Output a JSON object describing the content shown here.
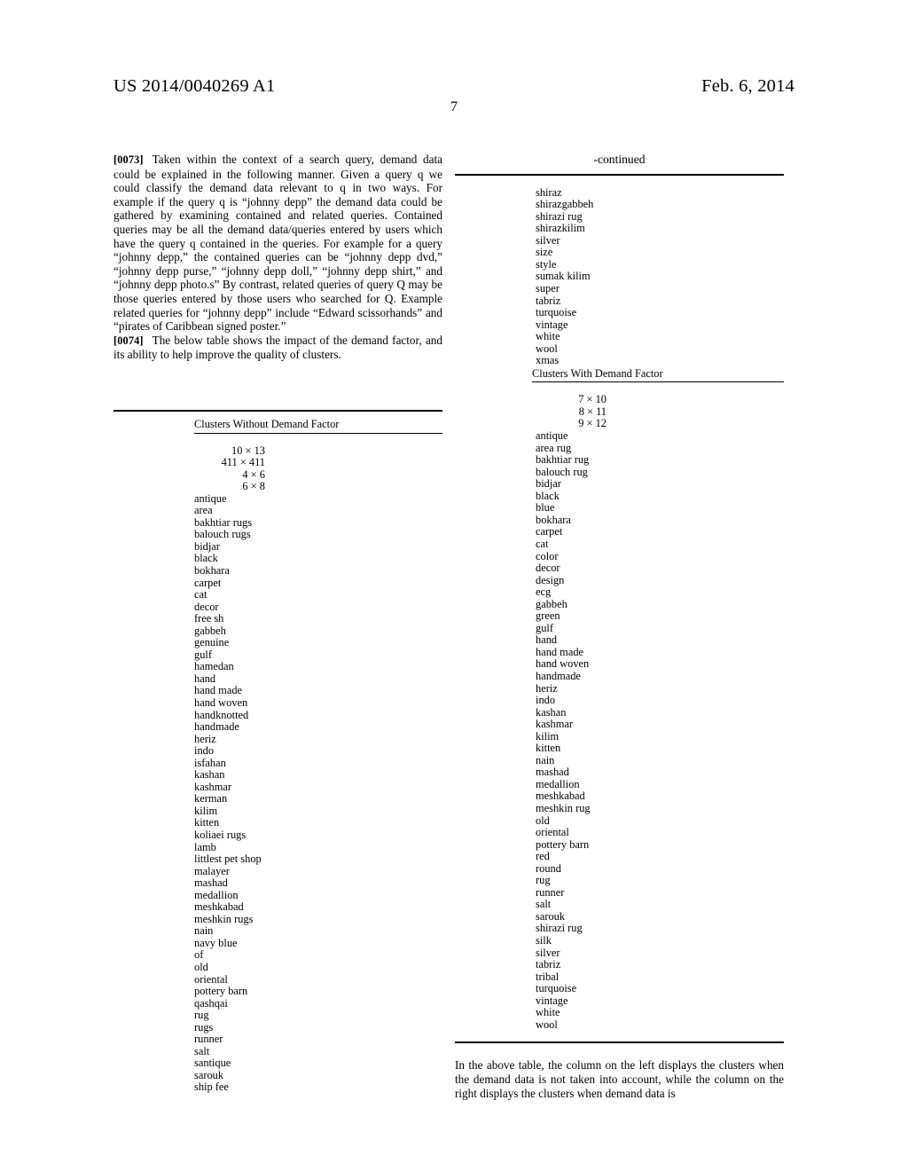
{
  "header": {
    "publication_number": "US 2014/0040269 A1",
    "publication_date": "Feb. 6, 2014",
    "page_number": "7"
  },
  "left_column": {
    "paragraphs": [
      {
        "label": "[0073]",
        "text": "Taken within the context of a search query, demand data could be explained in the following manner. Given a query q we could classify the demand data relevant to q in two ways. For example if the query q is “johnny depp” the demand data could be gathered by examining contained and related queries. Contained queries may be all the demand data/queries entered by users which have the query q contained in the queries. For example for a query “johnny depp,” the contained queries can be “johnny depp dvd,” “johnny depp purse,” “johnny depp doll,” “johnny depp shirt,” and “johnny depp photo.s” By contrast, related queries of query Q may be those queries entered by those users who searched for Q. Example related queries for “johnny depp” include “Edward scissorhands” and “pirates of Caribbean signed poster.”"
      },
      {
        "label": "[0074]",
        "text": "The below table shows the impact of the demand factor, and its ability to help improve the quality of clusters."
      }
    ],
    "table": {
      "title": "Clusters Without Demand Factor",
      "numeric_rows": [
        "10 × 13",
        "411 × 411",
        "4 × 6",
        "6 × 8"
      ],
      "word_rows": [
        "antique",
        "area",
        "bakhtiar rugs",
        "balouch rugs",
        "bidjar",
        "black",
        "bokhara",
        "carpet",
        "cat",
        "decor",
        "free sh",
        "gabbeh",
        "genuine",
        "gulf",
        "hamedan",
        "hand",
        "hand made",
        "hand woven",
        "handknotted",
        "handmade",
        "heriz",
        "indo",
        "isfahan",
        "kashan",
        "kashmar",
        "kerman",
        "kilim",
        "kitten",
        "koliaei rugs",
        "lamb",
        "littlest pet shop",
        "malayer",
        "mashad",
        "medallion",
        "meshkabad",
        "meshkin rugs",
        "nain",
        "navy blue",
        "of",
        "old",
        "oriental",
        "pottery barn",
        "qashqai",
        "rug",
        "rugs",
        "runner",
        "salt",
        "santique",
        "sarouk",
        "ship fee"
      ]
    }
  },
  "right_column": {
    "continued_label": "-continued",
    "continued_rows": [
      "shiraz",
      "shirazgabbeh",
      "shirazi rug",
      "shirazkilim",
      "silver",
      "size",
      "style",
      "sumak kilim",
      "super",
      "tabriz",
      "turquoise",
      "vintage",
      "white",
      "wool",
      "xmas"
    ],
    "table": {
      "title": "Clusters With Demand Factor",
      "numeric_rows": [
        "7 × 10",
        "8 × 11",
        "9 × 12"
      ],
      "word_rows": [
        "antique",
        "area rug",
        "bakhtiar rug",
        "balouch rug",
        "bidjar",
        "black",
        "blue",
        "bokhara",
        "carpet",
        "cat",
        "color",
        "decor",
        "design",
        "ecg",
        "gabbeh",
        "green",
        "gulf",
        "hand",
        "hand made",
        "hand woven",
        "handmade",
        "heriz",
        "indo",
        "kashan",
        "kashmar",
        "kilim",
        "kitten",
        "nain",
        "mashad",
        "medallion",
        "meshkabad",
        "meshkin rug",
        "old",
        "oriental",
        "pottery barn",
        "red",
        "round",
        "rug",
        "runner",
        "salt",
        "sarouk",
        "shirazi rug",
        "silk",
        "silver",
        "tabriz",
        "tribal",
        "turquoise",
        "vintage",
        "white",
        "wool"
      ]
    },
    "closing_paragraph": "In the above table, the column on the left displays the clusters when the demand data is not taken into account, while the column on the right displays the clusters when demand data is"
  }
}
